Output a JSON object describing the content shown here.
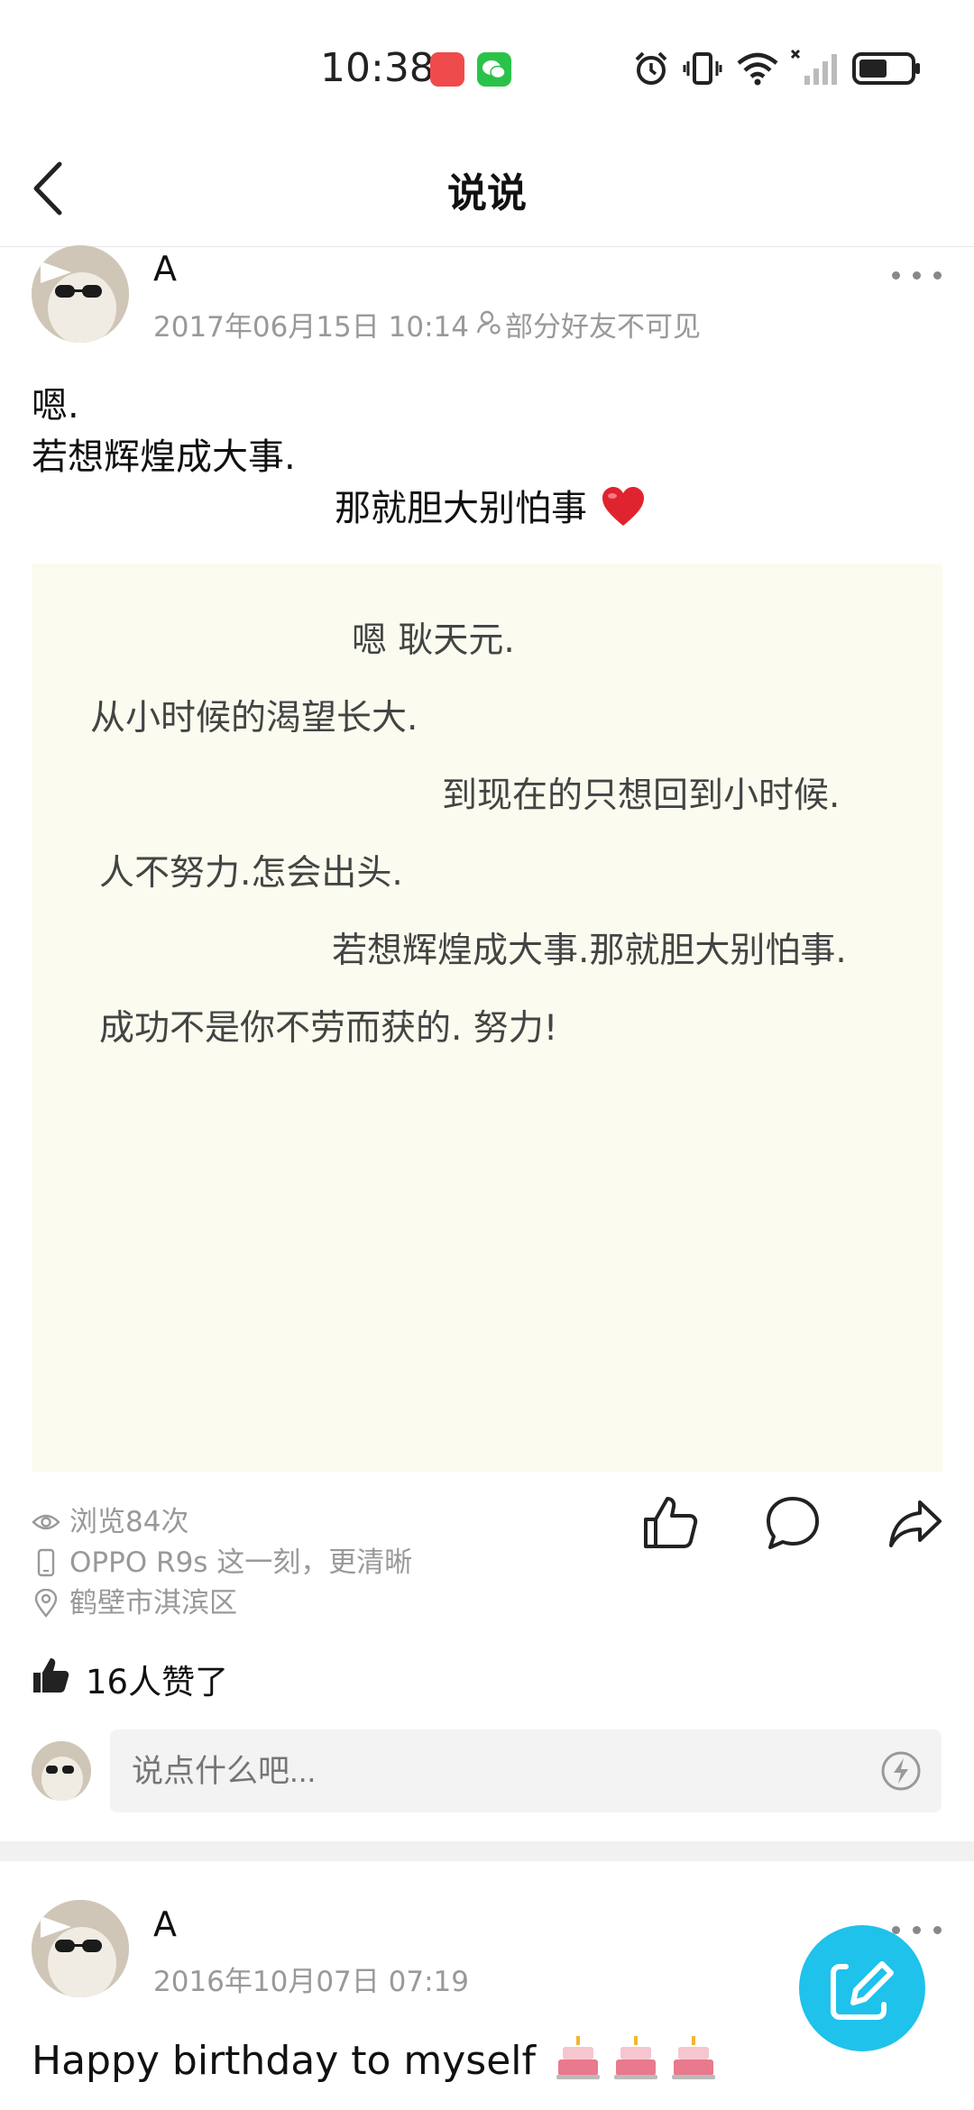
{
  "status_bar": {
    "time": "10:38",
    "app_icons": [
      "huawei-app-icon",
      "wechat-app-icon"
    ],
    "right_icons": [
      "alarm-icon",
      "vibrate-icon",
      "wifi-icon",
      "signal-icon",
      "battery-icon"
    ]
  },
  "nav": {
    "title": "说说"
  },
  "post1": {
    "author": "A",
    "date": "2017年06月15日 10:14",
    "visibility": "部分好友不可见",
    "text_lines": [
      "嗯.",
      "若想辉煌成大事.",
      "那就胆大别怕事"
    ],
    "text_image_lines": [
      "嗯 耿天元.",
      "从小时候的渴望长大.",
      "到现在的只想回到小时候.",
      "人不努力.怎会出头.",
      "若想辉煌成大事.那就胆大别怕事.",
      "成功不是你不劳而获的. 努力!"
    ],
    "views": "浏览84次",
    "device": "OPPO R9s 这一刻，更清晰",
    "location": "鹤壁市淇滨区",
    "likes": "16人赞了",
    "comment_placeholder": "说点什么吧..."
  },
  "post2": {
    "author": "A",
    "date": "2016年10月07日 07:19",
    "text": "Happy birthday to myself"
  },
  "colors": {
    "accent": "#1fc2eb",
    "text_image_bg": "#fbfcef",
    "heart": "#e0242f",
    "meta_text": "#999999"
  }
}
